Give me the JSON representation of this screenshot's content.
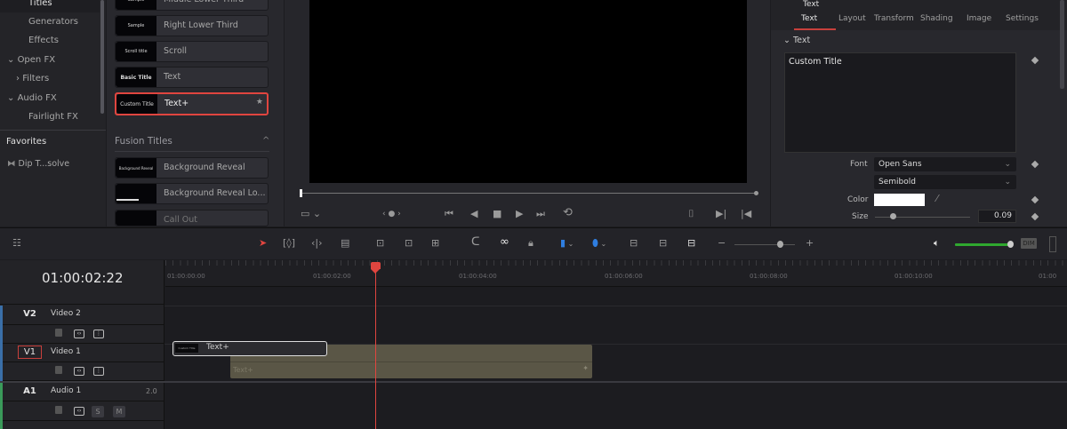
{
  "sidebar": {
    "items": [
      {
        "label": "Titles"
      },
      {
        "label": "Generators"
      },
      {
        "label": "Effects"
      },
      {
        "label": "Open FX"
      },
      {
        "label": "Filters"
      },
      {
        "label": "Audio FX"
      },
      {
        "label": "Fairlight FX"
      }
    ],
    "favorites_title": "Favorites",
    "favorites": [
      {
        "label": "Dip T...solve"
      }
    ]
  },
  "titles": {
    "items": [
      {
        "label": "Middle Lower Third",
        "thumb": "Sample"
      },
      {
        "label": "Right Lower Third",
        "thumb": "Sample"
      },
      {
        "label": "Scroll",
        "thumb": "Scroll title"
      },
      {
        "label": "Text",
        "thumb": "Basic Title"
      },
      {
        "label": "Text+",
        "thumb": "Custom Title"
      }
    ],
    "fusion_header": "Fusion Titles",
    "fusion_items": [
      {
        "label": "Background Reveal",
        "thumb": "Background Reveal"
      },
      {
        "label": "Background Reveal Lo...",
        "thumb": ""
      },
      {
        "label": "Call Out",
        "thumb": ""
      }
    ]
  },
  "inspector": {
    "header": "Text",
    "tabs": [
      "Text",
      "Layout",
      "Transform",
      "Shading",
      "Image",
      "Settings"
    ],
    "section": "Text",
    "text_value": "Custom Title",
    "font_label": "Font",
    "font": "Open Sans",
    "style": "Semibold",
    "color_label": "Color",
    "color_value": "#ffffff",
    "size_label": "Size",
    "size_value": "0.09"
  },
  "timeline": {
    "timecode": "01:00:02:22",
    "ruler": [
      "01:00:00:00",
      "01:00:02:00",
      "01:00:04:00",
      "01:00:06:00",
      "01:00:08:00",
      "01:00:10:00",
      "01:00"
    ],
    "tracks": [
      {
        "id": "V2",
        "name": "Video 2"
      },
      {
        "id": "V1",
        "name": "Video 1"
      },
      {
        "id": "A1",
        "name": "Audio 1",
        "ch": "2.0"
      }
    ],
    "clip_selected": "Text+",
    "clip_placed": "Text+",
    "clip_thumb": "Custom Title",
    "dim": "DIM",
    "solo": "S",
    "mute": "M"
  },
  "colors": {
    "accent": "#e0453f",
    "audio_level": "#2fa82f",
    "clip": "#5a5646"
  }
}
